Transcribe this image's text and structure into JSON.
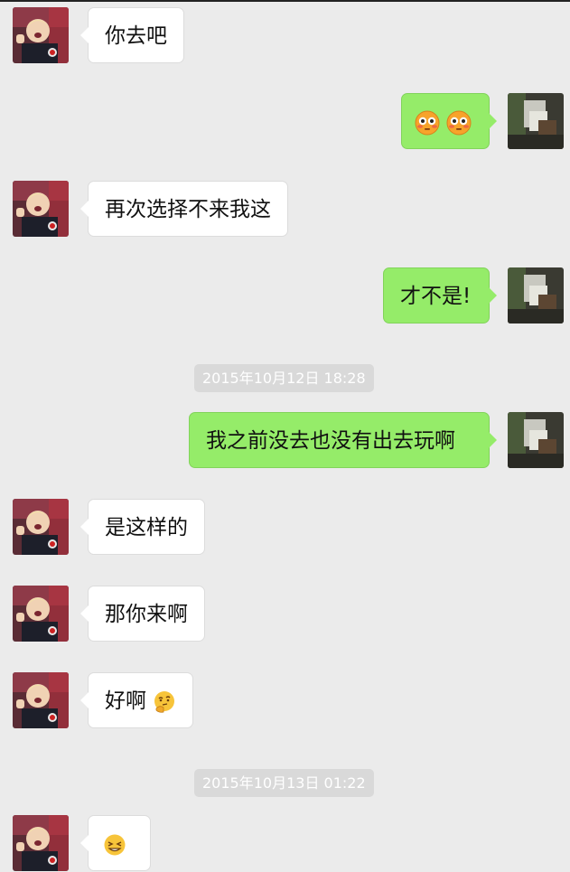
{
  "chat": {
    "messages": [
      {
        "side": "in",
        "text": "你去吧"
      },
      {
        "side": "out",
        "text": "",
        "emoji": [
          "flushed-face",
          "flushed-face"
        ]
      },
      {
        "side": "in",
        "text": "再次选择不来我这"
      },
      {
        "side": "out",
        "text": "才不是!"
      },
      {
        "side": "out",
        "text": "我之前没去也没有出去玩啊"
      },
      {
        "side": "in",
        "text": "是这样的"
      },
      {
        "side": "in",
        "text": "那你来啊"
      },
      {
        "side": "in",
        "text": "好啊",
        "emoji": [
          "thinking-face"
        ]
      },
      {
        "side": "in",
        "text": "",
        "emoji": [
          "squinting-face"
        ]
      }
    ],
    "timestamps": [
      "2015年10月12日 18:28",
      "2015年10月13日 01:22"
    ]
  },
  "colors": {
    "background": "#ebebeb",
    "outgoing_bubble": "#95ec69",
    "incoming_bubble": "#ffffff",
    "timestamp_bg": "#d9d9d9"
  }
}
